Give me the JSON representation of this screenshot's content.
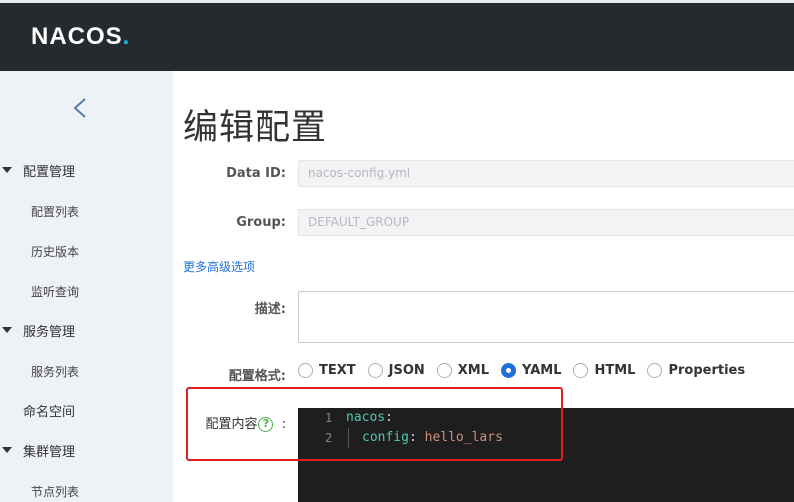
{
  "header": {
    "logo_main": "NACOS",
    "logo_dot": "."
  },
  "sidebar": {
    "groups": [
      {
        "label": "配置管理",
        "items": [
          "配置列表",
          "历史版本",
          "监听查询"
        ]
      },
      {
        "label": "服务管理",
        "items": [
          "服务列表"
        ]
      },
      {
        "label": "集群管理",
        "items": [
          "节点列表"
        ]
      }
    ],
    "namespace_label": "命名空间"
  },
  "page": {
    "title": "编辑配置"
  },
  "form": {
    "data_id_label": "Data ID:",
    "data_id_value": "nacos-config.yml",
    "group_label": "Group:",
    "group_value": "DEFAULT_GROUP",
    "more_options": "更多高级选项",
    "desc_label": "描述:",
    "format_label": "配置格式:",
    "formats": [
      "TEXT",
      "JSON",
      "XML",
      "YAML",
      "HTML",
      "Properties"
    ],
    "selected_format": "YAML",
    "content_label": "配置内容",
    "content_help": "?",
    "content_colon": ":"
  },
  "editor": {
    "lines": [
      {
        "num": "1",
        "key": "nacos",
        "colon": ":",
        "value": ""
      },
      {
        "num": "2",
        "key": "config",
        "colon": ":",
        "value": " hello_lars"
      }
    ]
  },
  "colors": {
    "accent": "#1e6fd9",
    "header_bg": "#252a2f",
    "highlight_box": "#e02020"
  }
}
